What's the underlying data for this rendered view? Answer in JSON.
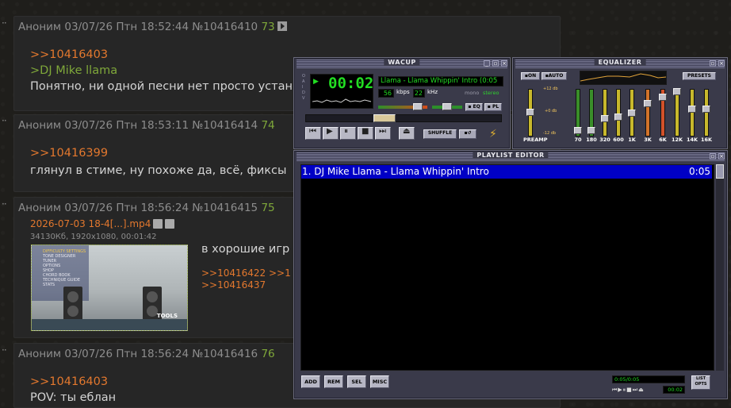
{
  "posts": [
    {
      "author": "Аноним",
      "date": "03/07/26 Птн 18:52:44",
      "num": "№10416410",
      "count": "73",
      "reply": ">>10416403",
      "quote": ">DJ Mike llama",
      "text": "Понятно, ни одной песни нет просто устан"
    },
    {
      "author": "Аноним",
      "date": "03/07/26 Птн 18:53:11",
      "num": "№10416414",
      "count": "74",
      "reply": ">>10416399",
      "text": "глянул в стиме, ну похоже да, всё, фиксы"
    },
    {
      "author": "Аноним",
      "date": "03/07/26 Птн 18:56:24",
      "num": "№10416415",
      "count": "75",
      "file_name": "2026-07-03 18-4[...].mp4",
      "file_meta": "34130Кб, 1920x1080, 00:01:42",
      "text": "в хорошие игр",
      "replies": [
        ">>10416422 >>1",
        ">>10416437"
      ],
      "thumb_menu": [
        "DIFFICULTY SETTINGS",
        "TONE DESIGNER",
        "TUNER",
        "OPTIONS",
        "SHOP",
        "CHORD BOOK",
        "TECHNIQUE GUIDE",
        "STATS"
      ],
      "thumb_label": "TOOLS"
    },
    {
      "author": "Аноним",
      "date": "03/07/26 Птн 18:56:24",
      "num": "№10416416",
      "count": "76",
      "reply": ">>10416403",
      "text": "POV: ты еблан"
    }
  ],
  "player": {
    "title": "WACUP",
    "time": "00:02",
    "song": "Llama - Llama Whippin' Intro (0:05",
    "kbps": "56",
    "kbps_label": "kbps",
    "khz": "22",
    "khz_label": "kHz",
    "mono": "mono",
    "stereo": "stereo",
    "eq_btn": "EQ",
    "pl_btn": "PL",
    "shuffle": "SHUFFLE"
  },
  "equalizer": {
    "title": "EQUALIZER",
    "on": "ON",
    "auto": "AUTO",
    "presets": "PRESETS",
    "db_top": "+12 db",
    "db_mid": "+0 db",
    "db_bot": "-12 db",
    "preamp": "PREAMP",
    "bands": [
      "70",
      "180",
      "320",
      "600",
      "1K",
      "3K",
      "6K",
      "12K",
      "14K",
      "16K"
    ],
    "colors": {
      "low": "#3a8e2a",
      "mid": "#c8b82c",
      "high": "#d2512a"
    }
  },
  "playlist": {
    "title": "PLAYLIST EDITOR",
    "items": [
      {
        "label": "1. DJ Mike Llama - Llama Whippin' Intro",
        "time": "0:05"
      }
    ],
    "buttons": [
      "ADD",
      "REM",
      "SEL",
      "MISC"
    ],
    "info": "0:05/0:05",
    "mini_time": "00:02",
    "list_opts": "LIST OPTS"
  }
}
